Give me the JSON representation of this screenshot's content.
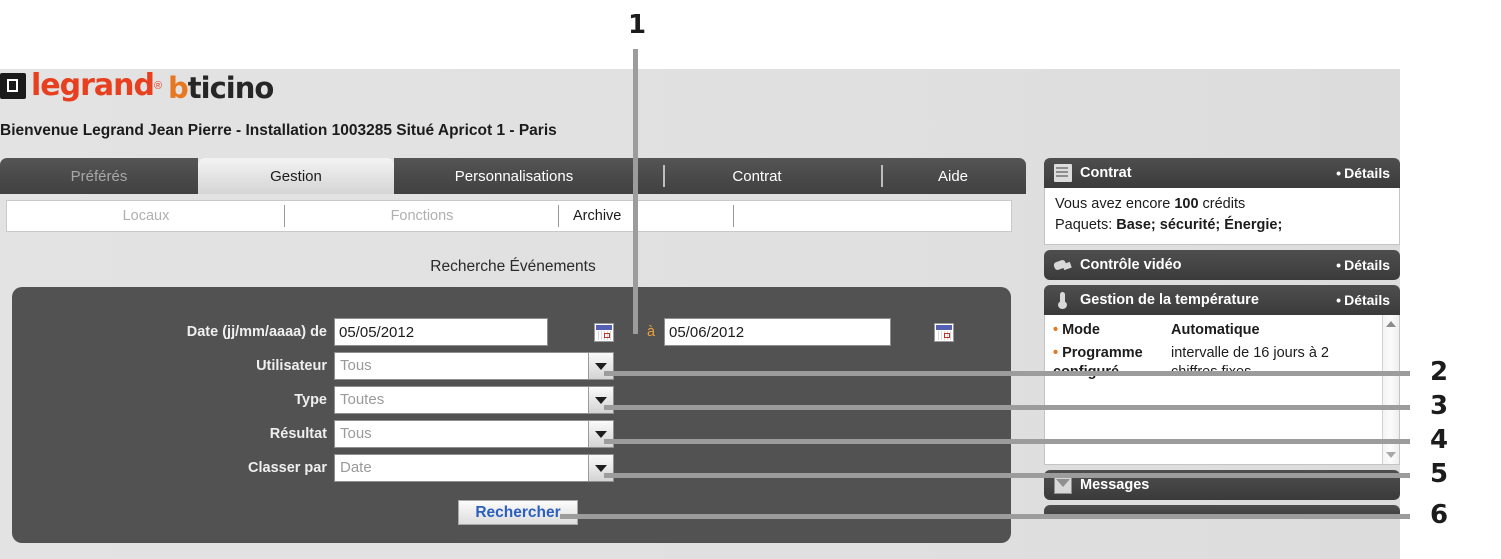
{
  "brand": {
    "legrand": "legrand",
    "legrand_reg": "®",
    "bticino_b": "b",
    "bticino_rest": "ticino"
  },
  "welcome": "Bienvenue Legrand Jean Pierre - Installation 1003285 Situé Apricot 1 - Paris",
  "tabs": [
    {
      "label": "Préférés",
      "state": "dim"
    },
    {
      "label": "Gestion",
      "state": "active"
    },
    {
      "label": "Personnalisations",
      "state": "normal"
    },
    {
      "label": "Contrat",
      "state": "normal"
    },
    {
      "label": "Aide",
      "state": "normal"
    }
  ],
  "subtabs": [
    {
      "label": "Locaux",
      "state": "dim"
    },
    {
      "label": "Fonctions",
      "state": "dim"
    },
    {
      "label": "Archive",
      "state": "active"
    },
    {
      "label": "",
      "state": "dim"
    }
  ],
  "section_title": "Recherche Événements",
  "form": {
    "date_label": "Date (jj/mm/aaaa) de",
    "date_from": "05/05/2012",
    "a_label": "à",
    "date_to": "05/06/2012",
    "calendar_icon": "calendar-icon",
    "fields": [
      {
        "label": "Utilisateur",
        "value": "Tous"
      },
      {
        "label": "Type",
        "value": "Toutes"
      },
      {
        "label": "Résultat",
        "value": "Tous"
      },
      {
        "label": "Classer par",
        "value": "Date"
      }
    ],
    "search_button": "Rechercher"
  },
  "sidebar": {
    "contract": {
      "icon": "document-icon",
      "title": "Contrat",
      "details": "Détails",
      "details_bullet": "•",
      "credits_pre": "Vous avez encore ",
      "credits_value": "100",
      "credits_post": " crédits",
      "packages_label": "Paquets: ",
      "packages_value": "Base; sécurité; Énergie;"
    },
    "video": {
      "icon": "video-camera-icon",
      "title": "Contrôle vidéo",
      "details": "Détails",
      "details_bullet": "•"
    },
    "temperature": {
      "icon": "thermometer-icon",
      "title": "Gestion de la température",
      "details": "Détails",
      "details_bullet": "•",
      "bullet": "•",
      "rows": [
        {
          "key": "Mode",
          "value": "Automatique",
          "bold": true
        },
        {
          "key": "Programme configuré",
          "value": "intervalle de 16 jours à 2 chiffres fixes",
          "bold": false
        }
      ]
    },
    "messages": {
      "icon": "envelope-icon",
      "title": "Messages"
    }
  },
  "callouts": [
    {
      "id": "1",
      "label": "1"
    },
    {
      "id": "2",
      "label": "2"
    },
    {
      "id": "3",
      "label": "3"
    },
    {
      "id": "4",
      "label": "4"
    },
    {
      "id": "5",
      "label": "5"
    },
    {
      "id": "6",
      "label": "6"
    }
  ],
  "colors": {
    "legrand_red": "#e8401f",
    "bticino_orange": "#e87722",
    "panel_dark": "#525252",
    "tab_dark": "#4a4a4a",
    "link_blue": "#2b5fbf",
    "accent_orange": "#e8761f"
  }
}
